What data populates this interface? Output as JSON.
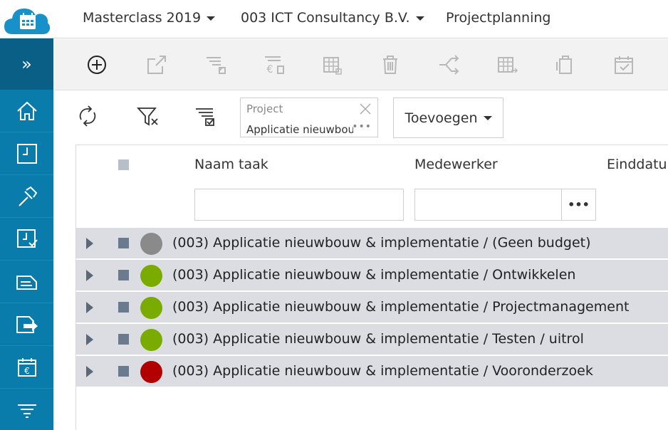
{
  "topbar": {
    "menus": [
      {
        "label": "Masterclass 2019"
      },
      {
        "label": "003 ICT Consultancy B.V."
      }
    ],
    "section": "Projectplanning"
  },
  "sidebar": {
    "toggle": "»",
    "items": [
      {
        "icon": "home-icon"
      },
      {
        "icon": "calendar-icon"
      },
      {
        "icon": "hammer-icon"
      },
      {
        "icon": "timesheet-approve-icon"
      },
      {
        "icon": "invoice-icon"
      },
      {
        "icon": "invoice-send-icon"
      },
      {
        "icon": "calendar-euro-icon"
      },
      {
        "icon": "filter-settings-icon"
      }
    ]
  },
  "filterbar": {
    "project_label": "Project",
    "project_value": "Applicatie nieuwbouw & implementatie",
    "more_dots": "•••",
    "add_label": "Toevoegen"
  },
  "grid": {
    "columns": [
      "Naam taak",
      "Medewerker",
      "Einddatum"
    ],
    "filter_dots": "•••",
    "rows": [
      {
        "text": "(003) Applicatie nieuwbouw & implementatie / (Geen budget)",
        "status": "grey"
      },
      {
        "text": "(003) Applicatie nieuwbouw & implementatie / Ontwikkelen",
        "status": "green"
      },
      {
        "text": "(003) Applicatie nieuwbouw & implementatie / Projectmanagement",
        "status": "green"
      },
      {
        "text": "(003) Applicatie nieuwbouw & implementatie / Testen / uitrol",
        "status": "green"
      },
      {
        "text": "(003) Applicatie nieuwbouw & implementatie / Vooronderzoek",
        "status": "red"
      }
    ]
  },
  "colors": {
    "sidebar": "#0a7cab",
    "sidebar_toggle": "#0a5f86",
    "status_grey": "#8a8a8a",
    "status_green": "#7aab00",
    "status_red": "#b20000",
    "row_bg": "#dcdde3"
  }
}
